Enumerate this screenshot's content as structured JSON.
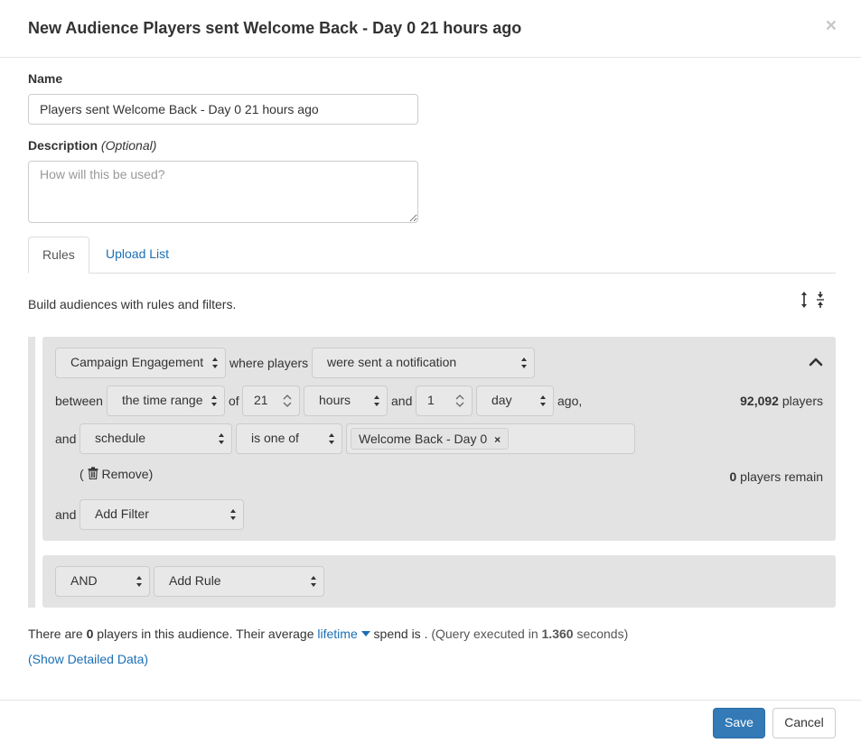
{
  "modal": {
    "title": "New Audience Players sent Welcome Back - Day 0 21 hours ago",
    "close_label": "×"
  },
  "form": {
    "name_label": "Name",
    "name_value": "Players sent Welcome Back - Day 0 21 hours ago",
    "description_label": "Description",
    "description_optional": "(Optional)",
    "description_placeholder": "How will this be used?"
  },
  "tabs": [
    {
      "label": "Rules",
      "active": true
    },
    {
      "label": "Upload List",
      "active": false
    }
  ],
  "rules_help": "Build audiences with rules and filters.",
  "rule": {
    "type_select": "Campaign Engagement",
    "where_players": "where players",
    "action_select": "were sent a notification",
    "between_label": "between",
    "time_select": "the time range",
    "of_label": "of",
    "from_value": "21",
    "from_unit": "hours",
    "and_label": "and",
    "to_value": "1",
    "to_unit": "day",
    "ago_label": "ago,",
    "players_count": "92,092",
    "players_label": "players",
    "filter_and": "and",
    "filter_field": "schedule",
    "filter_op": "is one of",
    "filter_tag": "Welcome Back - Day 0",
    "remove_open": "(",
    "remove_label": "Remove)",
    "remain_count": "0",
    "remain_label": "players remain",
    "add_filter_and": "and",
    "add_filter": "Add Filter"
  },
  "logic": {
    "operator": "AND",
    "add_rule": "Add Rule"
  },
  "summary": {
    "prefix": "There are ",
    "count": "0",
    "middle": " players in this audience. Their average ",
    "metric": "lifetime",
    "suffix": " spend is . ",
    "query_prefix": "(Query executed in ",
    "query_time": "1.360",
    "query_suffix": " seconds)"
  },
  "detail_link": "(Show Detailed Data)",
  "footer": {
    "save": "Save",
    "cancel": "Cancel"
  },
  "colors": {
    "primary": "#337ab7",
    "link": "#1a6fb5",
    "panel": "#e3e3e3"
  }
}
